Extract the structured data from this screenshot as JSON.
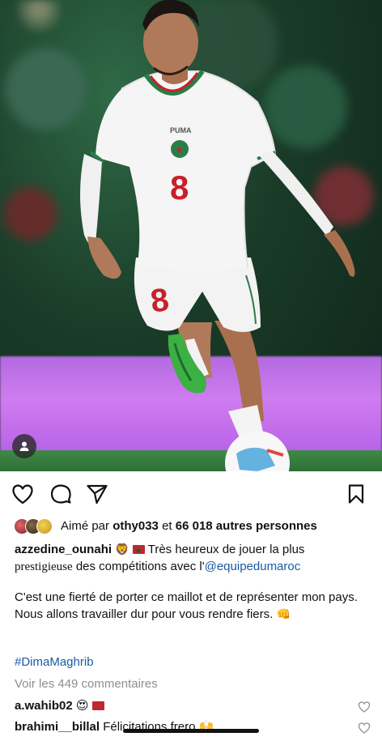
{
  "post": {
    "likes": {
      "prefix": "Aimé par",
      "user": "othy033",
      "connector": "et",
      "count": "66 018 autres personnes"
    },
    "caption": {
      "username": "azzedine_ounahi",
      "line1_text": "Très heureux de jouer la plus",
      "line2_styled": "prestigieuse",
      "line2_text": "des compétitions avec l'",
      "mention": "@equipedumaroc",
      "para2": "C'est une fierté de porter ce maillot et de représenter mon pays.",
      "para3": "Nous allons travailler dur pour vous rendre fiers."
    },
    "hashtag": "#DimaMaghrib",
    "view_comments": "Voir les 449 commentaires",
    "comments": [
      {
        "username": "a.wahib02",
        "text": ""
      },
      {
        "username": "brahimi__billal",
        "text": "Félicitations frero"
      }
    ],
    "photo": {
      "jersey_number": "8",
      "brand": "PUMA"
    }
  },
  "icons": {
    "like": "heart-icon",
    "comment": "comment-icon",
    "share": "send-icon",
    "save": "bookmark-icon",
    "tags": "user-tag-icon"
  },
  "colors": {
    "link": "#1a5aa3",
    "muted": "#8e8e8e",
    "flag_red": "#c1272d",
    "flag_green": "#006233"
  }
}
